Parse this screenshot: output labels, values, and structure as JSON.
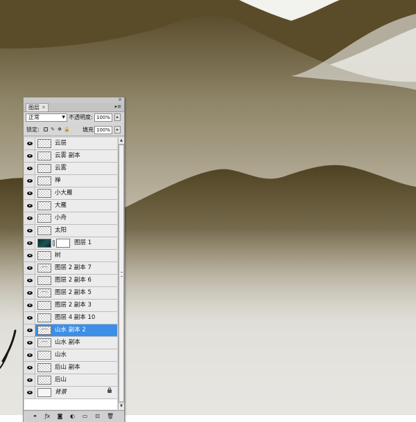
{
  "colors": {
    "selection": "#3d8ee6",
    "panel_bg": "#d6d6d6",
    "mountain_dark": "#4a3e22",
    "mist": "#e6e5e0"
  },
  "panel": {
    "tab_label": "图层",
    "tab_close": "×",
    "close_glyph": "×",
    "menu_glyph": "▸≡",
    "blend_mode": "正常",
    "blend_arrow": "▼",
    "opacity_label": "不透明度:",
    "opacity_value": "100%",
    "flyout_glyph": "▸",
    "lock_label": "锁定:",
    "lock_brush_glyph": "✎",
    "lock_move_glyph": "✥",
    "lock_all_glyph": "🔒",
    "fill_label": "填充:",
    "fill_value": "100%",
    "scroll_up": "▲",
    "scroll_down": "▼"
  },
  "layers": [
    {
      "name": "云层",
      "thumb": "transparent"
    },
    {
      "name": "云雾 副本",
      "thumb": "transparent"
    },
    {
      "name": "云雾",
      "thumb": "transparent"
    },
    {
      "name": "禅",
      "thumb": "transparent"
    },
    {
      "name": "小大雁",
      "thumb": "transparent"
    },
    {
      "name": "大雁",
      "thumb": "transparent"
    },
    {
      "name": "小舟",
      "thumb": "transparent"
    },
    {
      "name": "太阳",
      "thumb": "transparent"
    },
    {
      "name": "图层 1",
      "thumb": "teal",
      "has_mask": true
    },
    {
      "name": "树",
      "thumb": "transparent"
    },
    {
      "name": "图层 2 副本 7",
      "thumb": "sketch"
    },
    {
      "name": "图层 2 副本 6",
      "thumb": "transparent"
    },
    {
      "name": "图层 2 副本 5",
      "thumb": "sketch"
    },
    {
      "name": "图层 2 副本 3",
      "thumb": "transparent"
    },
    {
      "name": "图层 4 副本 10",
      "thumb": "transparent"
    },
    {
      "name": "山水 副本 2",
      "thumb": "sketch",
      "selected": true
    },
    {
      "name": "山水 副本",
      "thumb": "sketch"
    },
    {
      "name": "山水",
      "thumb": "transparent"
    },
    {
      "name": "后山 副本",
      "thumb": "transparent"
    },
    {
      "name": "后山",
      "thumb": "transparent"
    },
    {
      "name": "背景",
      "thumb": "white",
      "italic": true,
      "locked": true
    }
  ],
  "toolbar": [
    {
      "icon": "link-layers-icon",
      "glyph": "⚭"
    },
    {
      "icon": "layer-style-icon",
      "glyph": "ƒx"
    },
    {
      "icon": "add-mask-icon",
      "glyph": "◙"
    },
    {
      "icon": "adjustment-layer-icon",
      "glyph": "◐"
    },
    {
      "icon": "new-group-icon",
      "glyph": "▭"
    },
    {
      "icon": "new-layer-icon",
      "glyph": "⊡"
    },
    {
      "icon": "delete-layer-icon",
      "glyph": "🗑"
    }
  ]
}
